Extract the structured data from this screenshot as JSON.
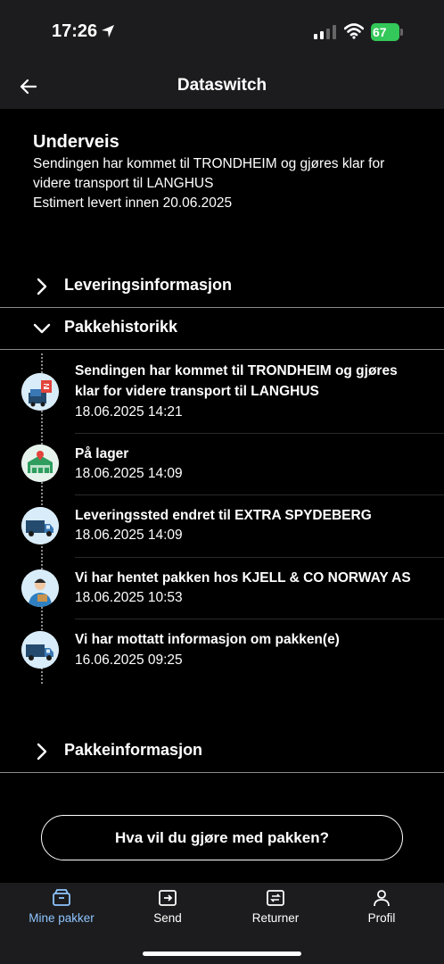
{
  "status_bar": {
    "time": "17:26",
    "battery": "67"
  },
  "header": {
    "title": "Dataswitch"
  },
  "shipment_status": {
    "title": "Underveis",
    "lines": [
      "Sendingen har kommet til TRONDHEIM og gjøres klar for",
      "videre transport til LANGHUS",
      "Estimert levert innen 20.06.2025"
    ]
  },
  "sections": {
    "delivery_info": "Leveringsinformasjon",
    "history": "Pakkehistorikk",
    "package_info": "Pakkeinformasjon"
  },
  "events": [
    {
      "title_lines": [
        "Sendingen har kommet til TRONDHEIM og gjøres",
        "klar for videre transport til LANGHUS"
      ],
      "time": "18.06.2025 14:21",
      "icon": "sorting-terminal-icon"
    },
    {
      "title_lines": [
        "På lager"
      ],
      "time": "18.06.2025 14:09",
      "icon": "warehouse-icon"
    },
    {
      "title_lines": [
        "Leveringssted endret til EXTRA SPYDEBERG"
      ],
      "time": "18.06.2025 14:09",
      "icon": "truck-icon"
    },
    {
      "title_lines": [
        "Vi har hentet pakken hos KJELL & CO NORWAY AS"
      ],
      "time": "18.06.2025 10:53",
      "icon": "courier-icon"
    },
    {
      "title_lines": [
        "Vi har mottatt informasjon om pakken(e)"
      ],
      "time": "16.06.2025 09:25",
      "icon": "truck-icon"
    }
  ],
  "action_button": "Hva vil du gjøre med pakken?",
  "tabs": [
    {
      "label": "Mine pakker",
      "icon": "package-icon",
      "active": true
    },
    {
      "label": "Send",
      "icon": "send-package-icon",
      "active": false
    },
    {
      "label": "Returner",
      "icon": "return-package-icon",
      "active": false
    },
    {
      "label": "Profil",
      "icon": "profile-icon",
      "active": false
    }
  ],
  "colors": {
    "accent": "#8ec5ff",
    "background": "#000000",
    "bar": "#1c1c1e",
    "battery": "#34c759"
  }
}
